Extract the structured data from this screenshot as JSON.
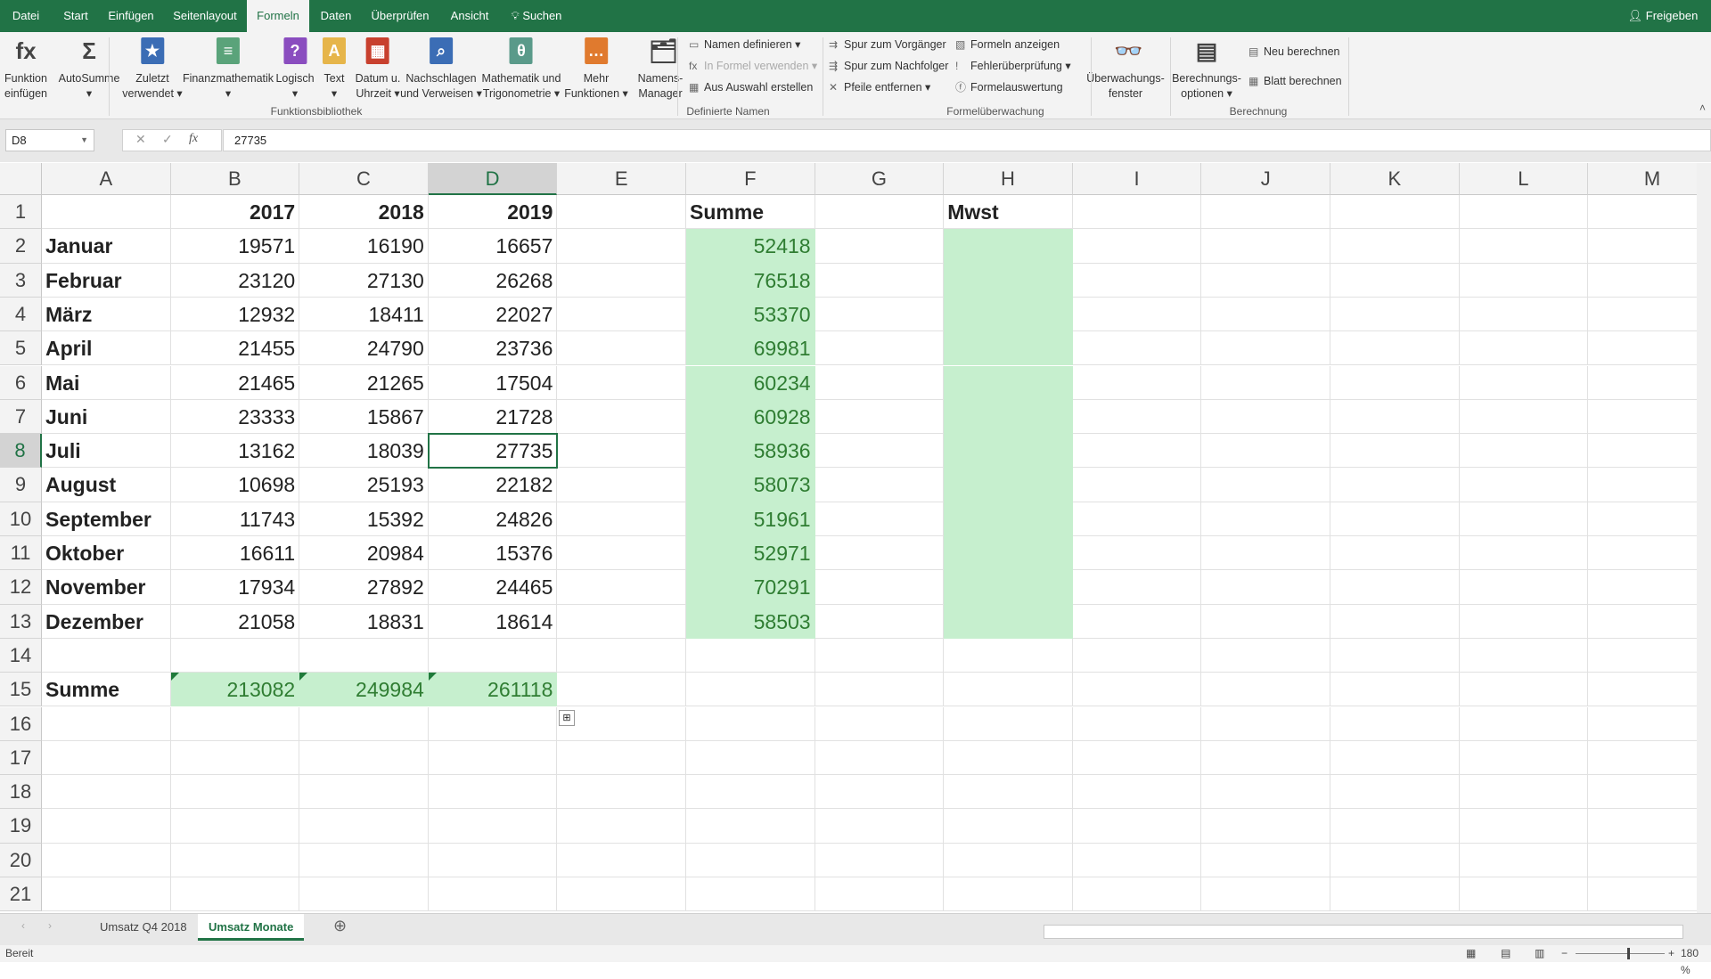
{
  "menu_tabs": [
    "Datei",
    "Start",
    "Einfügen",
    "Seitenlayout",
    "Formeln",
    "Daten",
    "Überprüfen",
    "Ansicht"
  ],
  "active_tab": "Formeln",
  "search_label": "Suchen",
  "share_label": "Freigeben",
  "ribbon": {
    "big_buttons": [
      {
        "label1": "Funktion",
        "label2": "einfügen",
        "icon": "fx",
        "color": "#f3f3f3"
      },
      {
        "label1": "AutoSumme",
        "label2": "▾",
        "icon": "Σ",
        "color": "#f3f3f3"
      },
      {
        "label1": "Zuletzt",
        "label2": "verwendet ▾",
        "icon": "★",
        "color": "#3b6db5"
      },
      {
        "label1": "Finanzmathematik",
        "label2": "▾",
        "icon": "≡",
        "color": "#5aa37a"
      },
      {
        "label1": "Logisch",
        "label2": "▾",
        "icon": "?",
        "color": "#8a4dbf"
      },
      {
        "label1": "Text",
        "label2": "▾",
        "icon": "A",
        "color": "#e6b54a"
      },
      {
        "label1": "Datum u.",
        "label2": "Uhrzeit ▾",
        "icon": "▦",
        "color": "#c8402e"
      },
      {
        "label1": "Nachschlagen",
        "label2": "und Verweisen ▾",
        "icon": "⌕",
        "color": "#3b6db5"
      },
      {
        "label1": "Mathematik und",
        "label2": "Trigonometrie ▾",
        "icon": "θ",
        "color": "#5a9a8a"
      },
      {
        "label1": "Mehr",
        "label2": "Funktionen ▾",
        "icon": "…",
        "color": "#e07a2e"
      },
      {
        "label1": "Namens-",
        "label2": "Manager",
        "icon": "🗂",
        "color": "#f3f3f3"
      },
      {
        "label1": "Überwachungs-",
        "label2": "fenster",
        "icon": "👓",
        "color": "#f3f3f3"
      },
      {
        "label1": "Berechnungs-",
        "label2": "optionen ▾",
        "icon": "▤",
        "color": "#f3f3f3"
      }
    ],
    "small_buttons": [
      {
        "label": "Namen definieren ▾",
        "icon": "▭",
        "disabled": false
      },
      {
        "label": "In Formel verwenden ▾",
        "icon": "fx",
        "disabled": true
      },
      {
        "label": "Aus Auswahl erstellen",
        "icon": "▦",
        "disabled": false
      },
      {
        "label": "Spur zum Vorgänger",
        "icon": "⇉",
        "disabled": false
      },
      {
        "label": "Spur zum Nachfolger",
        "icon": "⇶",
        "disabled": false
      },
      {
        "label": "Pfeile entfernen ▾",
        "icon": "✕",
        "disabled": false
      },
      {
        "label": "Formeln anzeigen",
        "icon": "▧",
        "disabled": false
      },
      {
        "label": "Fehlerüberprüfung ▾",
        "icon": "!",
        "disabled": false
      },
      {
        "label": "Formelauswertung",
        "icon": "ⓕ",
        "disabled": false
      },
      {
        "label": "Neu berechnen",
        "icon": "▤",
        "disabled": false
      },
      {
        "label": "Blatt berechnen",
        "icon": "▦",
        "disabled": false
      }
    ],
    "groups": [
      "Funktionsbibliothek",
      "Definierte Namen",
      "Formelüberwachung",
      "Berechnung"
    ]
  },
  "formula_bar": {
    "name_box": "D8",
    "value": "27735",
    "fx": "fx"
  },
  "columns": [
    "A",
    "B",
    "C",
    "D",
    "E",
    "F",
    "G",
    "H",
    "I",
    "J",
    "K",
    "L",
    "M"
  ],
  "selected_cell": {
    "col": "D",
    "row": 8
  },
  "rows": [
    [
      "",
      "2017",
      "2018",
      "2019",
      "",
      "Summe",
      "",
      "Mwst"
    ],
    [
      "Januar",
      "19571",
      "16190",
      "16657",
      "",
      "52418"
    ],
    [
      "Februar",
      "23120",
      "27130",
      "26268",
      "",
      "76518"
    ],
    [
      "März",
      "12932",
      "18411",
      "22027",
      "",
      "53370"
    ],
    [
      "April",
      "21455",
      "24790",
      "23736",
      "",
      "69981"
    ],
    [
      "Mai",
      "21465",
      "21265",
      "17504",
      "",
      "60234"
    ],
    [
      "Juni",
      "23333",
      "15867",
      "21728",
      "",
      "60928"
    ],
    [
      "Juli",
      "13162",
      "18039",
      "27735",
      "",
      "58936"
    ],
    [
      "August",
      "10698",
      "25193",
      "22182",
      "",
      "58073"
    ],
    [
      "September",
      "11743",
      "15392",
      "24826",
      "",
      "51961"
    ],
    [
      "Oktober",
      "16611",
      "20984",
      "15376",
      "",
      "52971"
    ],
    [
      "November",
      "17934",
      "27892",
      "24465",
      "",
      "70291"
    ],
    [
      "Dezember",
      "21058",
      "18831",
      "18614",
      "",
      "58503"
    ],
    [],
    [
      "Summe",
      "213082",
      "249984",
      "261118"
    ],
    [],
    [],
    [],
    [],
    [],
    []
  ],
  "highlight_fill": "#c6efce",
  "highlight_text": "#2f7d32",
  "sheets": [
    "Umsatz Q4 2018",
    "Umsatz Monate"
  ],
  "active_sheet": "Umsatz Monate",
  "status": "Bereit",
  "zoom": "180 %"
}
